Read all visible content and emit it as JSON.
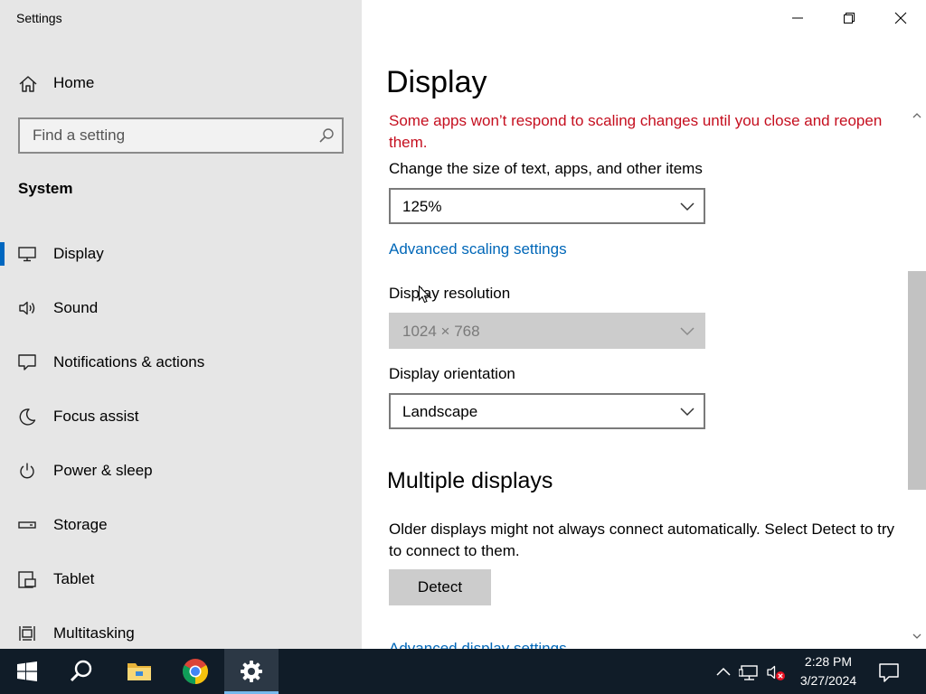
{
  "window": {
    "title": "Settings"
  },
  "sidebar": {
    "home_label": "Home",
    "search_placeholder": "Find a setting",
    "section_title": "System",
    "items": [
      {
        "label": "Display",
        "icon": "monitor-icon",
        "active": true
      },
      {
        "label": "Sound",
        "icon": "speaker-icon"
      },
      {
        "label": "Notifications & actions",
        "icon": "message-icon"
      },
      {
        "label": "Focus assist",
        "icon": "moon-icon"
      },
      {
        "label": "Power & sleep",
        "icon": "power-icon"
      },
      {
        "label": "Storage",
        "icon": "storage-icon"
      },
      {
        "label": "Tablet",
        "icon": "tablet-icon"
      },
      {
        "label": "Multitasking",
        "icon": "multitasking-icon"
      }
    ]
  },
  "main": {
    "title": "Display",
    "warning": "Some apps won’t respond to scaling changes until you close and reopen them.",
    "scale_label": "Change the size of text, apps, and other items",
    "scale_value": "125%",
    "advanced_scaling_link": "Advanced scaling settings",
    "resolution_label": "Display resolution",
    "resolution_value": "1024 × 768",
    "orientation_label": "Display orientation",
    "orientation_value": "Landscape",
    "multiple_displays_title": "Multiple displays",
    "multiple_displays_text": "Older displays might not always connect automatically. Select Detect to try to connect to them.",
    "detect_label": "Detect",
    "advanced_display_link": "Advanced display settings"
  },
  "taskbar": {
    "time": "2:28 PM",
    "date": "3/27/2024"
  },
  "colors": {
    "accent": "#0067c0",
    "link": "#0067b8",
    "warning": "#c50f1f",
    "sidebar_bg": "#e6e6e6",
    "taskbar_bg": "#101c28"
  }
}
